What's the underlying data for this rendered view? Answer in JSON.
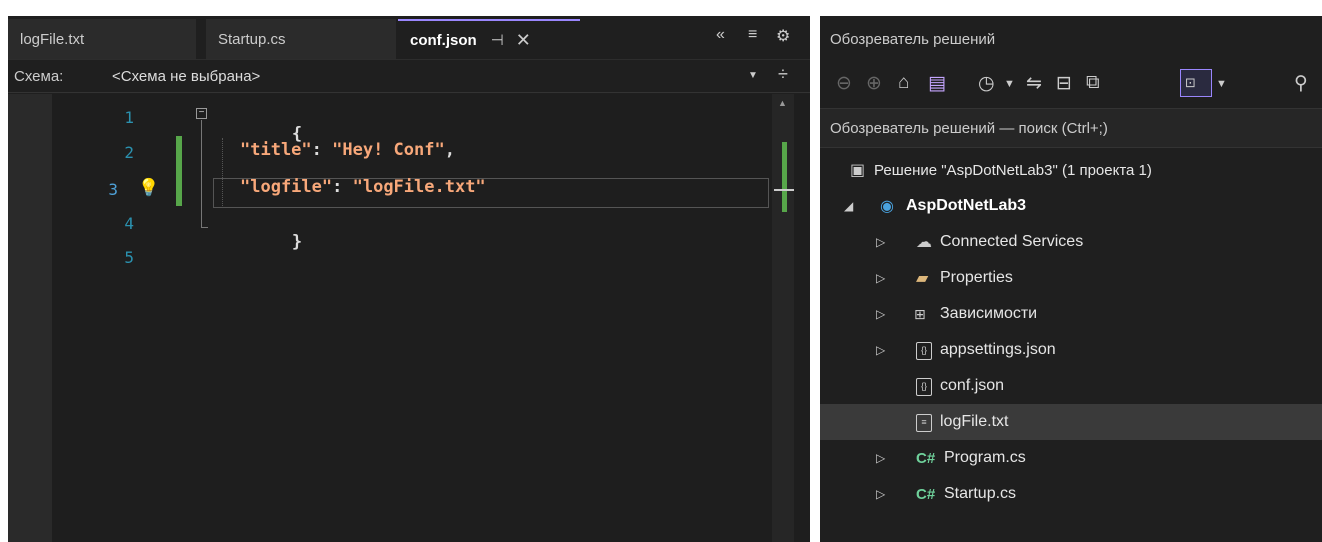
{
  "editor": {
    "tabs": [
      {
        "label": "logFile.txt",
        "active": false
      },
      {
        "label": "Startup.cs",
        "active": false
      },
      {
        "label": "conf.json",
        "active": true
      }
    ],
    "tab_pin_glyph": "⊣",
    "tab_close_glyph": "✕",
    "schema_label": "Схема:",
    "schema_value": "<Схема не выбрана>",
    "line_numbers": [
      "1",
      "2",
      "3",
      "4",
      "5"
    ],
    "code": {
      "line1_brace": "{",
      "line2_key": "\"title\"",
      "line2_sep": ": ",
      "line2_value": "\"Hey! Conf\"",
      "line2_comma": ",",
      "line3_key": "\"logfile\"",
      "line3_sep": ": ",
      "line3_value": "\"logFile.txt\"",
      "line4_brace": "}"
    },
    "accent_color": "#9a86fd",
    "change_color": "#57a64a"
  },
  "explorer": {
    "title": "Обозреватель решений",
    "search_placeholder": "Обозреватель решений — поиск (Ctrl+;)",
    "solution_label": "Решение \"AspDotNetLab3\"  (1 проекта 1)",
    "project_label": "AspDotNetLab3",
    "items": [
      {
        "label": "Connected Services",
        "icon": "cloud-service-icon",
        "expandable": true
      },
      {
        "label": "Properties",
        "icon": "wrench-folder-icon",
        "expandable": true
      },
      {
        "label": "Зависимости",
        "icon": "dependencies-icon",
        "expandable": true
      },
      {
        "label": "appsettings.json",
        "icon": "json-file-icon",
        "expandable": true
      },
      {
        "label": "conf.json",
        "icon": "json-file-icon",
        "expandable": false
      },
      {
        "label": "logFile.txt",
        "icon": "text-file-icon",
        "expandable": false,
        "selected": true
      },
      {
        "label": "Program.cs",
        "icon": "csharp-file-icon",
        "expandable": true
      },
      {
        "label": "Startup.cs",
        "icon": "csharp-file-icon",
        "expandable": true
      }
    ],
    "csharp_glyph": "C#",
    "json_glyph": "{}"
  }
}
